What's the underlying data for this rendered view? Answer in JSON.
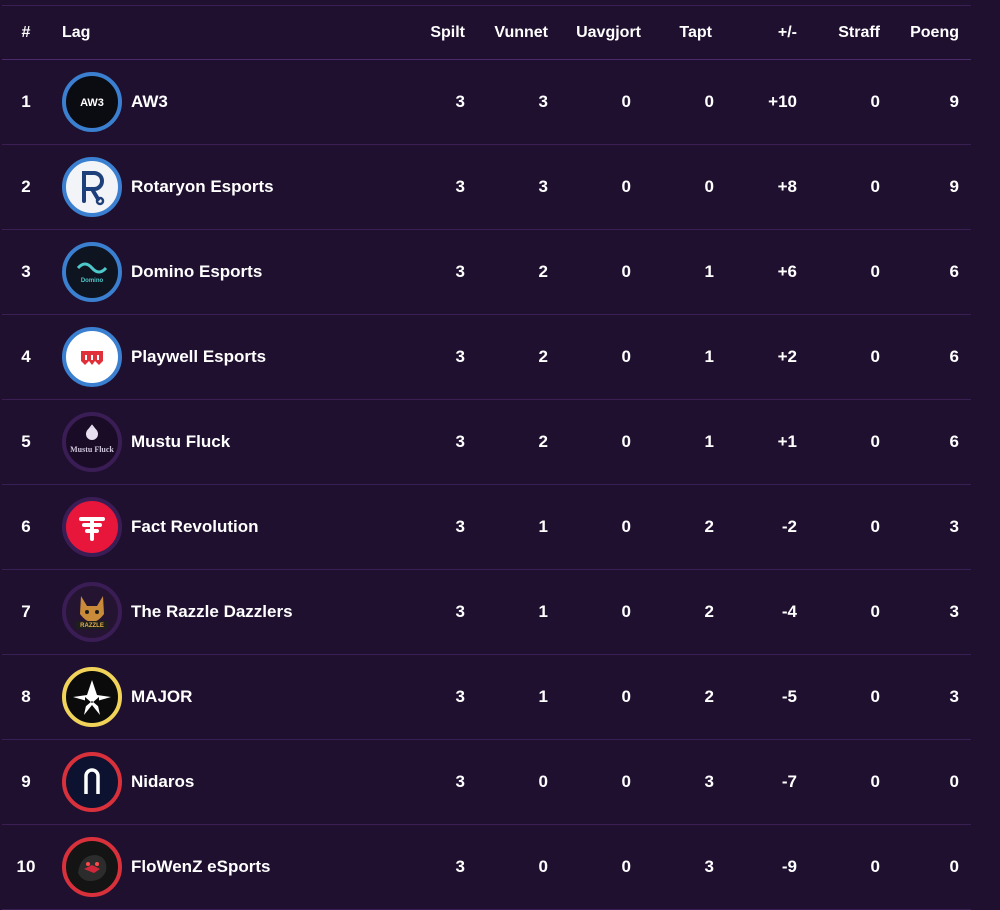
{
  "columns": {
    "rank": "#",
    "team": "Lag",
    "played": "Spilt",
    "won": "Vunnet",
    "draw": "Uavgjort",
    "lost": "Tapt",
    "diff": "+/-",
    "penalty": "Straff",
    "points": "Poeng"
  },
  "rows": [
    {
      "rank": "1",
      "team": "AW3",
      "played": "3",
      "won": "3",
      "draw": "0",
      "lost": "0",
      "diff": "+10",
      "penalty": "0",
      "points": "9",
      "logo": {
        "icon": "aw3-logo-icon",
        "logo_text": "AW3",
        "ring": "#3b7fd0",
        "bg": "#0b0b12"
      }
    },
    {
      "rank": "2",
      "team": "Rotaryon Esports",
      "played": "3",
      "won": "3",
      "draw": "0",
      "lost": "0",
      "diff": "+8",
      "penalty": "0",
      "points": "9",
      "logo": {
        "icon": "rotaryon-logo-icon",
        "ring": "#3b7fd0",
        "bg": "#f2f4f8"
      }
    },
    {
      "rank": "3",
      "team": "Domino Esports",
      "played": "3",
      "won": "2",
      "draw": "0",
      "lost": "1",
      "diff": "+6",
      "penalty": "0",
      "points": "6",
      "logo": {
        "icon": "domino-logo-icon",
        "logo_text": "Domino",
        "ring": "#3b7fd0",
        "bg": "#0e1420"
      }
    },
    {
      "rank": "4",
      "team": "Playwell Esports",
      "played": "3",
      "won": "2",
      "draw": "0",
      "lost": "1",
      "diff": "+2",
      "penalty": "0",
      "points": "6",
      "logo": {
        "icon": "playwell-logo-icon",
        "ring": "#3b7fd0",
        "bg": "#ffffff"
      }
    },
    {
      "rank": "5",
      "team": "Mustu Fluck",
      "played": "3",
      "won": "2",
      "draw": "0",
      "lost": "1",
      "diff": "+1",
      "penalty": "0",
      "points": "6",
      "logo": {
        "icon": "mustu-fluck-logo-icon",
        "logo_text": "Mustu Fluck",
        "ring": "#3a1d55",
        "bg": "#1a0c26"
      }
    },
    {
      "rank": "6",
      "team": "Fact Revolution",
      "played": "3",
      "won": "1",
      "draw": "0",
      "lost": "2",
      "diff": "-2",
      "penalty": "0",
      "points": "3",
      "logo": {
        "icon": "fact-revolution-logo-icon",
        "ring": "#3a1d55",
        "bg": "#e8163a"
      }
    },
    {
      "rank": "7",
      "team": "The Razzle Dazzlers",
      "played": "3",
      "won": "1",
      "draw": "0",
      "lost": "2",
      "diff": "-4",
      "penalty": "0",
      "points": "3",
      "logo": {
        "icon": "razzle-dazzlers-logo-icon",
        "logo_text": "RAZZLE",
        "ring": "#3a1d55",
        "bg": "#241432"
      }
    },
    {
      "rank": "8",
      "team": "MAJOR",
      "played": "3",
      "won": "1",
      "draw": "0",
      "lost": "2",
      "diff": "-5",
      "penalty": "0",
      "points": "3",
      "logo": {
        "icon": "major-logo-icon",
        "ring": "#f2d35a",
        "bg": "#0b0b0b"
      }
    },
    {
      "rank": "9",
      "team": "Nidaros",
      "played": "3",
      "won": "0",
      "draw": "0",
      "lost": "3",
      "diff": "-7",
      "penalty": "0",
      "points": "0",
      "logo": {
        "icon": "nidaros-logo-icon",
        "ring": "#d8313c",
        "bg": "#0c1230"
      }
    },
    {
      "rank": "10",
      "team": "FloWenZ eSports",
      "played": "3",
      "won": "0",
      "draw": "0",
      "lost": "3",
      "diff": "-9",
      "penalty": "0",
      "points": "0",
      "logo": {
        "icon": "flowenz-logo-icon",
        "ring": "#d8313c",
        "bg": "#141414"
      }
    }
  ]
}
